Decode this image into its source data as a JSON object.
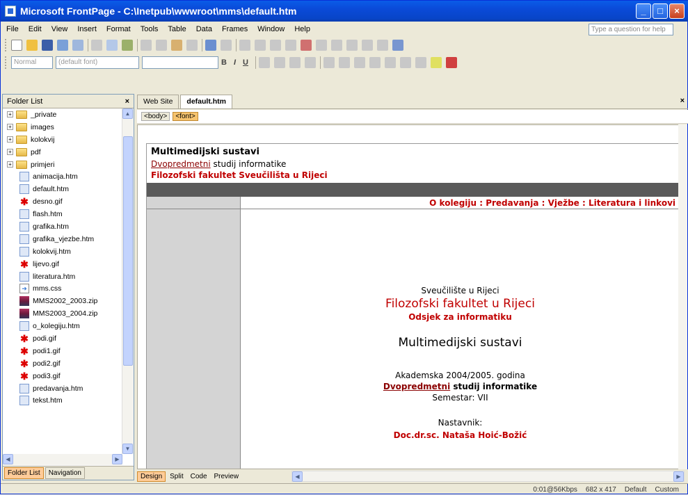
{
  "window": {
    "title": "Microsoft FrontPage - C:\\Inetpub\\wwwroot\\mms\\default.htm"
  },
  "menu": [
    "File",
    "Edit",
    "View",
    "Insert",
    "Format",
    "Tools",
    "Table",
    "Data",
    "Frames",
    "Window",
    "Help"
  ],
  "help_placeholder": "Type a question for help",
  "format_toolbar": {
    "style": "Normal",
    "font": "(default font)",
    "bold": "B",
    "italic": "I",
    "underline": "U"
  },
  "folder_panel": {
    "title": "Folder List",
    "items": [
      {
        "name": "_private",
        "type": "folder"
      },
      {
        "name": "images",
        "type": "folder"
      },
      {
        "name": "kolokvij",
        "type": "folder"
      },
      {
        "name": "pdf",
        "type": "folder"
      },
      {
        "name": "primjeri",
        "type": "folder"
      },
      {
        "name": "animacija.htm",
        "type": "htm"
      },
      {
        "name": "default.htm",
        "type": "htm"
      },
      {
        "name": "desno.gif",
        "type": "gif"
      },
      {
        "name": "flash.htm",
        "type": "htm"
      },
      {
        "name": "grafika.htm",
        "type": "htm"
      },
      {
        "name": "grafika_vjezbe.htm",
        "type": "htm"
      },
      {
        "name": "kolokvij.htm",
        "type": "htm"
      },
      {
        "name": "lijevo.gif",
        "type": "gif"
      },
      {
        "name": "literatura.htm",
        "type": "htm"
      },
      {
        "name": "mms.css",
        "type": "css"
      },
      {
        "name": "MMS2002_2003.zip",
        "type": "zip"
      },
      {
        "name": "MMS2003_2004.zip",
        "type": "zip"
      },
      {
        "name": "o_kolegiju.htm",
        "type": "htm"
      },
      {
        "name": "podi.gif",
        "type": "gif"
      },
      {
        "name": "podi1.gif",
        "type": "gif"
      },
      {
        "name": "podi2.gif",
        "type": "gif"
      },
      {
        "name": "podi3.gif",
        "type": "gif"
      },
      {
        "name": "predavanja.htm",
        "type": "htm"
      },
      {
        "name": "tekst.htm",
        "type": "htm"
      }
    ],
    "tabs": [
      "Folder List",
      "Navigation"
    ]
  },
  "editor": {
    "tabs": [
      "Web Site",
      "default.htm"
    ],
    "tags": [
      "<body>",
      "<font>"
    ],
    "view_tabs": [
      "Design",
      "Split",
      "Code",
      "Preview"
    ]
  },
  "page": {
    "header_title": "Multimedijski sustavi",
    "header_sub_underlined": "Dvopredmetni",
    "header_sub_rest": " studij informatike",
    "header_faculty": "Filozofski fakultet Sveučilišta u Rijeci",
    "nav": "O kolegiju : Predavanja : Vježbe : Literatura i linkovi",
    "university": "Sveučilište u Rijeci",
    "faculty": "Filozofski fakultet u Rijeci",
    "department": "Odsjek za informatiku",
    "course": "Multimedijski sustavi",
    "year": "Akademska 2004/2005. godina",
    "study_underlined": "Dvopredmetni",
    "study_rest": " studij informatike",
    "semester": "Semestar: VII",
    "teacher_label": "Nastavnik:",
    "teacher": "Doc.dr.sc. Nataša Hoić-Božić"
  },
  "status": {
    "speed": "0:01@56Kbps",
    "size": "682 x 417",
    "mode1": "Default",
    "mode2": "Custom"
  }
}
